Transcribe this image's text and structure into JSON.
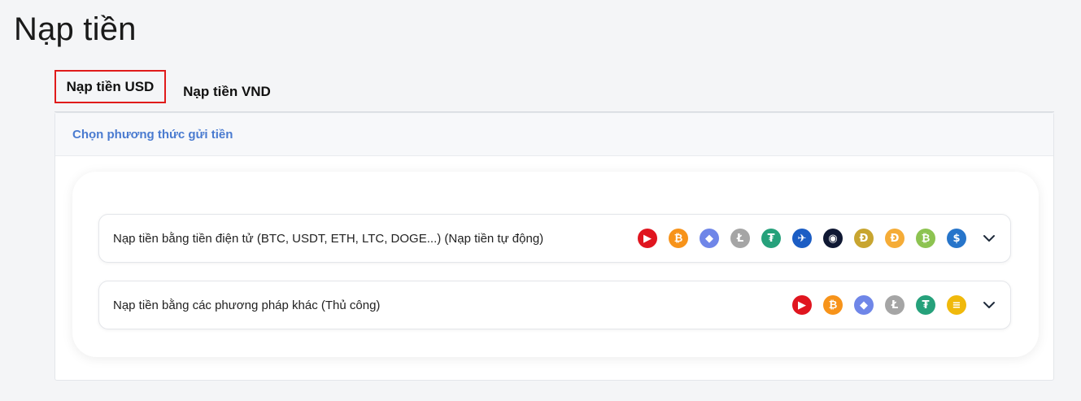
{
  "page": {
    "title": "Nạp tiền"
  },
  "tabs": [
    {
      "label": "Nạp tiền USD",
      "active": true
    },
    {
      "label": "Nạp tiền VND",
      "active": false
    }
  ],
  "panel": {
    "header": "Chọn phương thức gửi tiền"
  },
  "methods": [
    {
      "label": "Nạp tiền bằng tiền điện tử (BTC, USDT, ETH, LTC, DOGE...) (Nạp tiền tự động)",
      "icons": [
        {
          "name": "tron-icon",
          "color": "#e0151f",
          "glyph": "▶"
        },
        {
          "name": "bitcoin-icon",
          "color": "#f7931a",
          "glyph": "₿"
        },
        {
          "name": "ethereum-icon",
          "color": "#6f86e8",
          "glyph": "◆"
        },
        {
          "name": "litecoin-icon",
          "color": "#a5a5a5",
          "glyph": "Ł"
        },
        {
          "name": "tether-icon",
          "color": "#26a17b",
          "glyph": "₮"
        },
        {
          "name": "dogwifhat-icon",
          "color": "#1b5dc4",
          "glyph": "✈"
        },
        {
          "name": "shiba-inu-icon",
          "color": "#0f1833",
          "glyph": "◉"
        },
        {
          "name": "dogecoin-icon",
          "color": "#c8a530",
          "glyph": "Đ"
        },
        {
          "name": "dai-icon",
          "color": "#f5ac37",
          "glyph": "Ð"
        },
        {
          "name": "bitcoin-cash-icon",
          "color": "#8dc351",
          "glyph": "₿"
        },
        {
          "name": "usd-coin-icon",
          "color": "#2775ca",
          "glyph": "$"
        }
      ]
    },
    {
      "label": "Nạp tiền bằng các phương pháp khác (Thủ công)",
      "icons": [
        {
          "name": "tron-icon",
          "color": "#e0151f",
          "glyph": "▶"
        },
        {
          "name": "bitcoin-icon",
          "color": "#f7931a",
          "glyph": "₿"
        },
        {
          "name": "ethereum-icon",
          "color": "#6f86e8",
          "glyph": "◆"
        },
        {
          "name": "litecoin-icon",
          "color": "#a5a5a5",
          "glyph": "Ł"
        },
        {
          "name": "tether-icon",
          "color": "#26a17b",
          "glyph": "₮"
        },
        {
          "name": "binance-usd-icon",
          "color": "#f0b90b",
          "glyph": "≡"
        }
      ]
    }
  ]
}
